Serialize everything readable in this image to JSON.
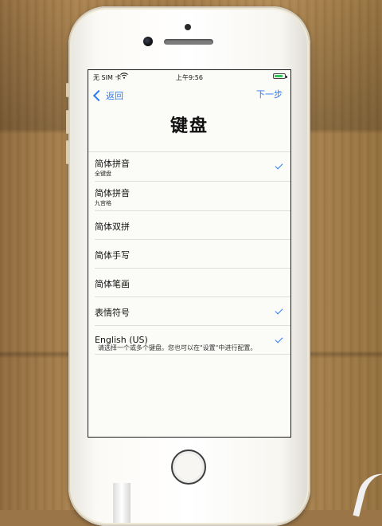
{
  "status_bar": {
    "carrier": "无 SIM 卡",
    "time": "上午9:56",
    "battery_level": 0.8
  },
  "nav": {
    "back_label": "返回",
    "next_label": "下一步"
  },
  "page_title": "键盘",
  "keyboards": [
    {
      "label": "简体拼音",
      "sublabel": "全键盘",
      "checked": true
    },
    {
      "label": "简体拼音",
      "sublabel": "九宫格",
      "checked": false
    },
    {
      "label": "简体双拼",
      "sublabel": "",
      "checked": false
    },
    {
      "label": "简体手写",
      "sublabel": "",
      "checked": false
    },
    {
      "label": "简体笔画",
      "sublabel": "",
      "checked": false
    },
    {
      "label": "表情符号",
      "sublabel": "",
      "checked": true
    },
    {
      "label": "English (US)",
      "sublabel": "",
      "checked": true
    }
  ],
  "footer_text": "请选择一个或多个键盘。您也可以在\"设置\"中进行配置。",
  "colors": {
    "accent": "#2a7cf6",
    "battery": "#34c759"
  }
}
